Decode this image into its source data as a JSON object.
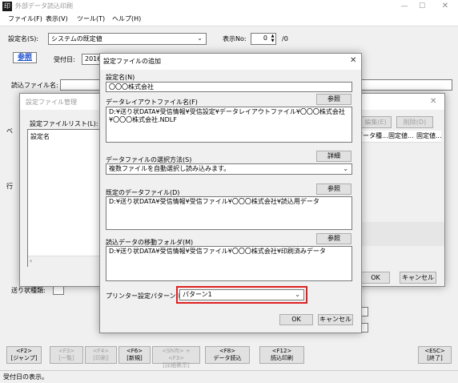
{
  "window": {
    "title": "外部データ読込印刷",
    "menu": [
      "ファイル(F)",
      "表示(V)",
      "ツール(T)",
      "ヘルプ(H)"
    ]
  },
  "main": {
    "setting_label": "設定名(S):",
    "setting_value": "システムの既定値",
    "display_no_label": "表示No:",
    "display_no_value": "0",
    "display_no_total": "/0",
    "browse_button": "参照",
    "received_date_label": "受付日:",
    "received_date_value": "2016.",
    "read_file_label": "読込ファイル名:",
    "copies_label": "送り状種類:"
  },
  "manager": {
    "title": "設定ファイル管理",
    "list_label": "設定ファイルリスト(L):",
    "list_header": "設定名",
    "edit_button": "編集(E)",
    "delete_button": "削除(D)",
    "col_headers": [
      "データ種...",
      "固定値...",
      "固定値..."
    ],
    "ok_button": "OK",
    "cancel_button": "キャンセル"
  },
  "dialog": {
    "title": "設定ファイルの追加",
    "name_label": "設定名(N)",
    "name_value": "〇〇〇株式会社",
    "layout_label": "データレイアウトファイル名(F)",
    "layout_browse": "参照",
    "layout_value": "D:¥送り状DATA¥受信情報¥受信設定¥データレイアウトファイル¥〇〇〇株式会社¥〇〇〇株式会社.NDLF",
    "select_method_label": "データファイルの選択方法(S)",
    "select_method_detail": "詳細",
    "select_method_value": "複数ファイルを自動選択し読み込みます。",
    "default_file_label": "既定のデータファイル(D)",
    "default_file_browse": "参照",
    "default_file_value": "D:¥送り状DATA¥受信情報¥受信ファイル¥〇〇〇株式会社¥読込用データ",
    "move_folder_label": "読込データの移動フォルダ(M)",
    "move_folder_browse": "参照",
    "move_folder_value": "D:¥送り状DATA¥受信情報¥受信ファイル¥〇〇〇株式会社¥印刷済みデータ",
    "printer_label": "プリンター設定パターン(P):",
    "printer_value": "パターン1",
    "ok_button": "OK",
    "cancel_button": "キャンセル",
    "highlight_color": "#e02020"
  },
  "fkeys": [
    {
      "key": "<F2>",
      "label": "[ジャンプ]",
      "enabled": true
    },
    {
      "key": "<F3>",
      "label": "[一覧]",
      "enabled": false
    },
    {
      "key": "<F4>",
      "label": "[印刷]",
      "enabled": false
    },
    {
      "key": "<F6>",
      "label": "[新規]",
      "enabled": true
    },
    {
      "key": "<Shift> + <F3>",
      "label": "[詳細表示]",
      "enabled": false
    },
    {
      "key": "<F8>",
      "label": "データ読込",
      "enabled": true
    },
    {
      "key": "<F12>",
      "label": "読込印刷",
      "enabled": true
    },
    {
      "key": "<ESC>",
      "label": "[終了]",
      "enabled": true
    }
  ],
  "status": {
    "text": "受付日の表示。"
  }
}
